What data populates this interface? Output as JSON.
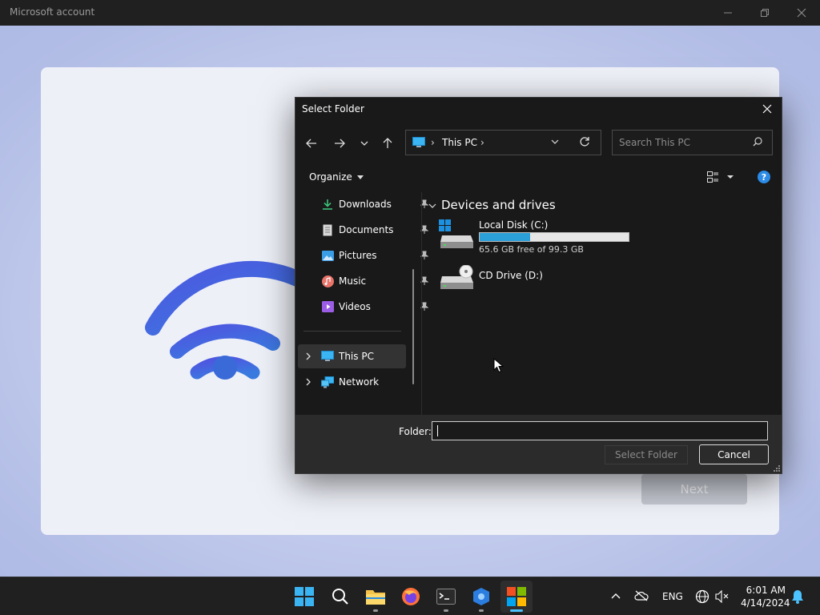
{
  "window": {
    "title": "Microsoft account"
  },
  "setup": {
    "next_label": "Next"
  },
  "dialog": {
    "title": "Select Folder",
    "address": {
      "crumb": "This PC",
      "sep": "›"
    },
    "search": {
      "placeholder": "Search This PC"
    },
    "toolbar": {
      "organize_label": "Organize"
    },
    "help_label": "?",
    "nav": {
      "quick_access": [
        {
          "label": "Downloads",
          "icon": "download-icon"
        },
        {
          "label": "Documents",
          "icon": "documents-icon"
        },
        {
          "label": "Pictures",
          "icon": "pictures-icon"
        },
        {
          "label": "Music",
          "icon": "music-icon"
        },
        {
          "label": "Videos",
          "icon": "videos-icon"
        }
      ],
      "this_pc": "This PC",
      "network": "Network"
    },
    "content": {
      "group_header": "Devices and drives",
      "drives": [
        {
          "name": "Local Disk (C:)",
          "free_text": "65.6 GB free of 99.3 GB",
          "used_fraction": 0.34
        },
        {
          "name": "CD Drive (D:)"
        }
      ]
    },
    "footer": {
      "folder_label": "Folder:",
      "folder_value": "",
      "select_label": "Select Folder",
      "cancel_label": "Cancel"
    }
  },
  "taskbar": {
    "apps": [
      "start",
      "search",
      "file-explorer",
      "firefox",
      "terminal",
      "app-store-blue",
      "microsoft-store"
    ],
    "language": "ENG",
    "time": "6:01 AM",
    "date": "4/14/2024"
  },
  "colors": {
    "accent": "#2a9fd8",
    "wifi": "#3f6ae0",
    "dialog_bg": "#191919"
  }
}
